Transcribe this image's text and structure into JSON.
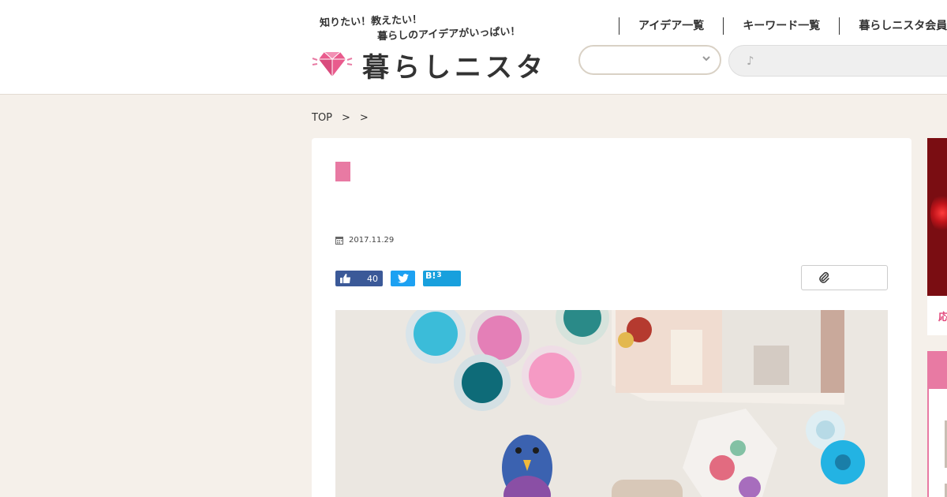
{
  "header": {
    "tagline1": "知りたい！教えたい！",
    "tagline2": "暮らしのアイデアがいっぱい！",
    "site_name": "暮らしニスタ",
    "nav": [
      "アイデア一覧",
      "キーワード一覧",
      "暮らしニスタ会員"
    ],
    "search_placeholder": "♪",
    "select_value": ""
  },
  "breadcrumb": [
    "TOP",
    ">",
    ">"
  ],
  "article": {
    "date": "2017.11.29",
    "like_count": "40",
    "hatena_label": "B!",
    "hatena_count": "3"
  },
  "sidebar": {
    "text": "応"
  },
  "colors": {
    "brand_pink": "#e87aa3",
    "background": "#f5f0ea",
    "facebook": "#3b5998",
    "twitter": "#1da1f2",
    "hatena": "#18a0dd"
  },
  "icons": [
    "gem-icon",
    "chevron-down-icon",
    "calendar-icon",
    "thumbs-up-icon",
    "twitter-icon",
    "paperclip-icon"
  ]
}
